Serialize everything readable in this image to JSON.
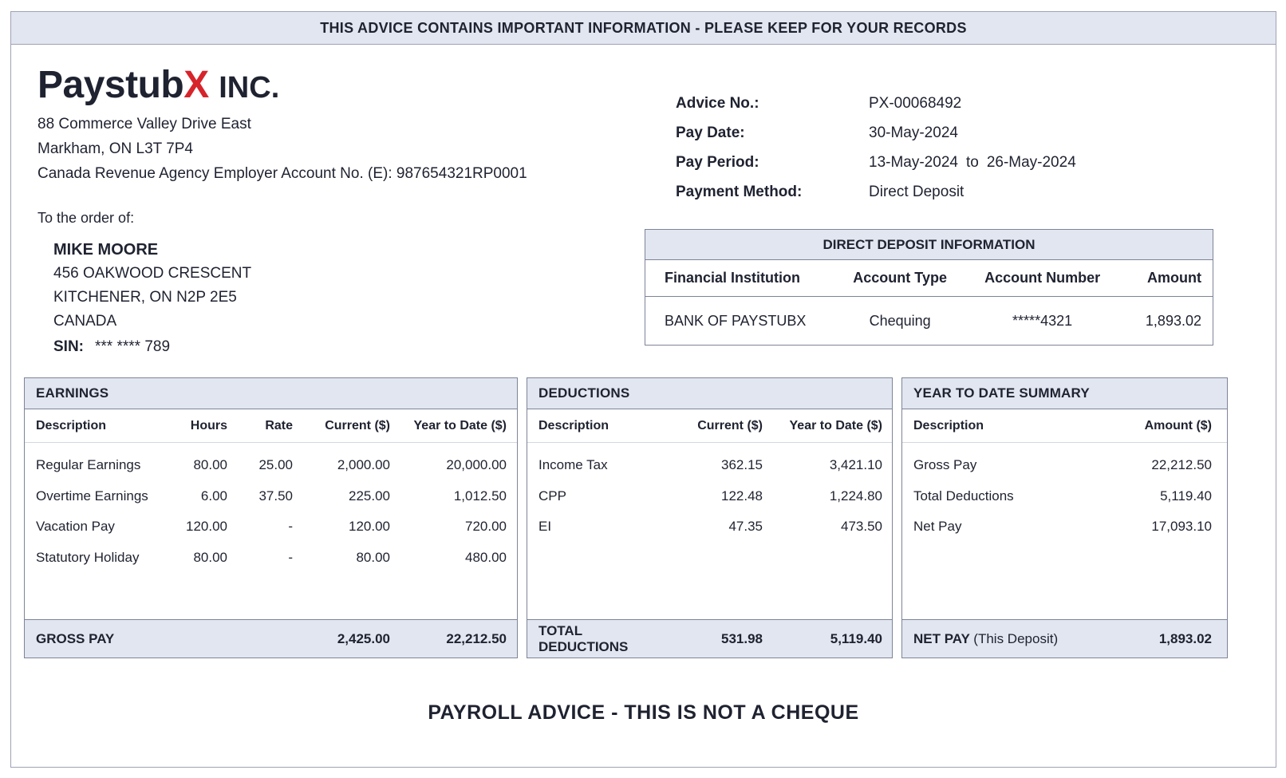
{
  "banner": "THIS ADVICE CONTAINS IMPORTANT INFORMATION - PLEASE KEEP FOR YOUR RECORDS",
  "company": {
    "brand_main": "Paystub",
    "brand_x": "X",
    "brand_suffix": "INC.",
    "brand_color": "#d7242b",
    "address_line1": "88 Commerce Valley Drive East",
    "address_line2": "Markham, ON  L3T 7P4",
    "employer_account": "Canada Revenue Agency Employer Account No. (E): 987654321RP0001"
  },
  "payee": {
    "order_label": "To the order of:",
    "name": "MIKE MOORE",
    "address_line1": "456 OAKWOOD CRESCENT",
    "address_line2": "KITCHENER, ON  N2P 2E5",
    "country": "CANADA",
    "sin_label": "SIN:",
    "sin_value": "*** **** 789"
  },
  "advice": {
    "advice_no_label": "Advice No.:",
    "advice_no": "PX-00068492",
    "pay_date_label": "Pay Date:",
    "pay_date": "30-May-2024",
    "pay_period_label": "Pay Period:",
    "pay_period_start": "13-May-2024",
    "pay_period_to": "to",
    "pay_period_end": "26-May-2024",
    "payment_method_label": "Payment Method:",
    "payment_method": "Direct Deposit"
  },
  "direct_deposit": {
    "title": "DIRECT DEPOSIT INFORMATION",
    "columns": [
      "Financial Institution",
      "Account Type",
      "Account Number",
      "Amount"
    ],
    "row": [
      "BANK OF PAYSTUBX",
      "Chequing",
      "*****4321",
      "1,893.02"
    ]
  },
  "earnings": {
    "title": "EARNINGS",
    "columns": [
      "Description",
      "Hours",
      "Rate",
      "Current ($)",
      "Year to Date ($)"
    ],
    "rows": [
      [
        "Regular Earnings",
        "80.00",
        "25.00",
        "2,000.00",
        "20,000.00"
      ],
      [
        "Overtime Earnings",
        "6.00",
        "37.50",
        "225.00",
        "1,012.50"
      ],
      [
        "Vacation Pay",
        "120.00",
        "-",
        "120.00",
        "720.00"
      ],
      [
        "Statutory Holiday",
        "80.00",
        "-",
        "80.00",
        "480.00"
      ]
    ],
    "total_label": "GROSS PAY",
    "total_current": "2,425.00",
    "total_ytd": "22,212.50"
  },
  "deductions": {
    "title": "DEDUCTIONS",
    "columns": [
      "Description",
      "Current ($)",
      "Year to Date ($)"
    ],
    "rows": [
      [
        "Income Tax",
        "362.15",
        "3,421.10"
      ],
      [
        "CPP",
        "122.48",
        "1,224.80"
      ],
      [
        "EI",
        "47.35",
        "473.50"
      ]
    ],
    "total_label": "TOTAL DEDUCTIONS",
    "total_current": "531.98",
    "total_ytd": "5,119.40"
  },
  "ytd_summary": {
    "title": "YEAR TO DATE SUMMARY",
    "columns": [
      "Description",
      "Amount ($)"
    ],
    "rows": [
      [
        "Gross Pay",
        "22,212.50"
      ],
      [
        "Total Deductions",
        "5,119.40"
      ],
      [
        "Net Pay",
        "17,093.10"
      ]
    ],
    "total_label": "NET PAY",
    "total_label_note": "(This Deposit)",
    "total_amount": "1,893.02"
  },
  "footer": "PAYROLL ADVICE - THIS IS NOT A CHEQUE"
}
